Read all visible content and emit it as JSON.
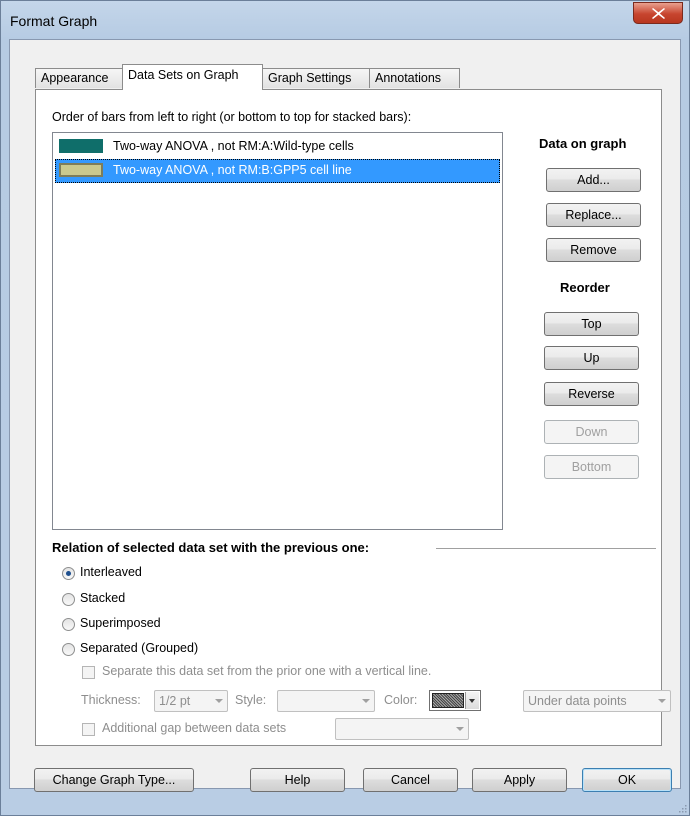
{
  "window": {
    "title": "Format Graph"
  },
  "tabs": [
    {
      "label": "Appearance"
    },
    {
      "label": "Data Sets on Graph"
    },
    {
      "label": "Graph Settings"
    },
    {
      "label": "Annotations"
    }
  ],
  "order_label": "Order of bars from left to right (or bottom to top for stacked bars):",
  "datasets": [
    {
      "label": "Two-way ANOVA , not RM:A:Wild-type cells",
      "color": "#0f6e6a",
      "selected": false
    },
    {
      "label": "Two-way ANOVA , not RM:B:GPP5 cell line",
      "color": "#c9c98f",
      "selected": true
    }
  ],
  "data_on_graph": {
    "heading": "Data on graph",
    "add": "Add...",
    "replace": "Replace...",
    "remove": "Remove"
  },
  "reorder": {
    "heading": "Reorder",
    "top": "Top",
    "up": "Up",
    "reverse": "Reverse",
    "down": "Down",
    "bottom": "Bottom"
  },
  "relation": {
    "heading": "Relation of selected data set with the previous one:",
    "options": [
      {
        "label": "Interleaved",
        "checked": true
      },
      {
        "label": "Stacked",
        "checked": false
      },
      {
        "label": "Superimposed",
        "checked": false
      },
      {
        "label": "Separated (Grouped)",
        "checked": false
      }
    ],
    "separate_checkbox": "Separate this data set from the prior one with a vertical line.",
    "thickness_label": "Thickness:",
    "thickness_value": "1/2 pt",
    "style_label": "Style:",
    "style_value": "",
    "color_label": "Color:",
    "position_value": "Under data points",
    "gap_checkbox": "Additional gap between data sets",
    "gap_value": ""
  },
  "footer": {
    "change_type": "Change Graph Type...",
    "help": "Help",
    "cancel": "Cancel",
    "apply": "Apply",
    "ok": "OK"
  }
}
